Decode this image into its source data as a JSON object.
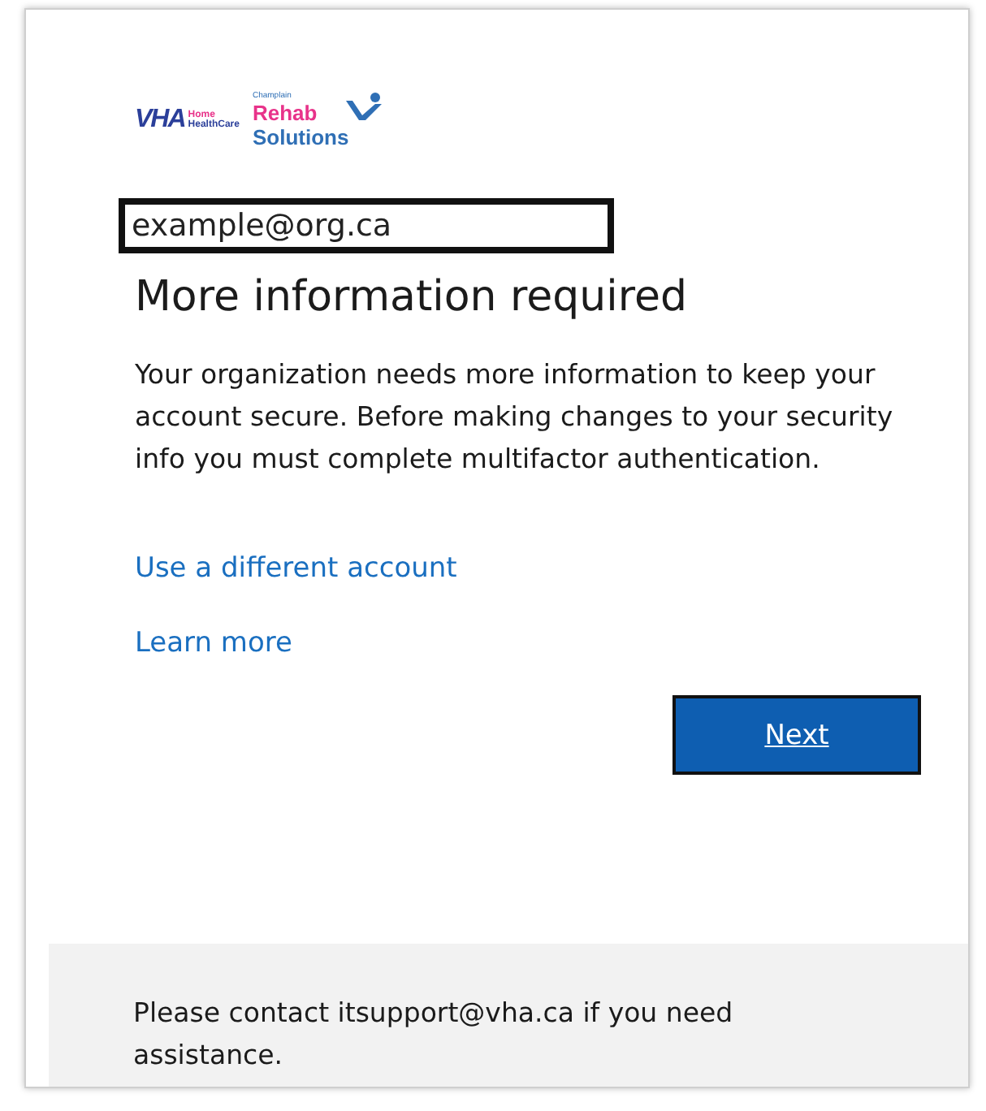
{
  "logo": {
    "left_mark": "VHA",
    "left_tag": [
      "Home",
      "HealthCare"
    ],
    "right_top": "Champlain",
    "right_mid": "Rehab",
    "right_bottom": "Solutions"
  },
  "account": "example@org.ca",
  "title": "More information required",
  "description": "Your organization needs more information to keep your account secure. Before making changes to your security info you must complete multifactor authentication.",
  "links": [
    "Use a different account",
    "Learn more"
  ],
  "button": "Next",
  "footer": "Please contact itsupport@vha.ca if you need assistance."
}
